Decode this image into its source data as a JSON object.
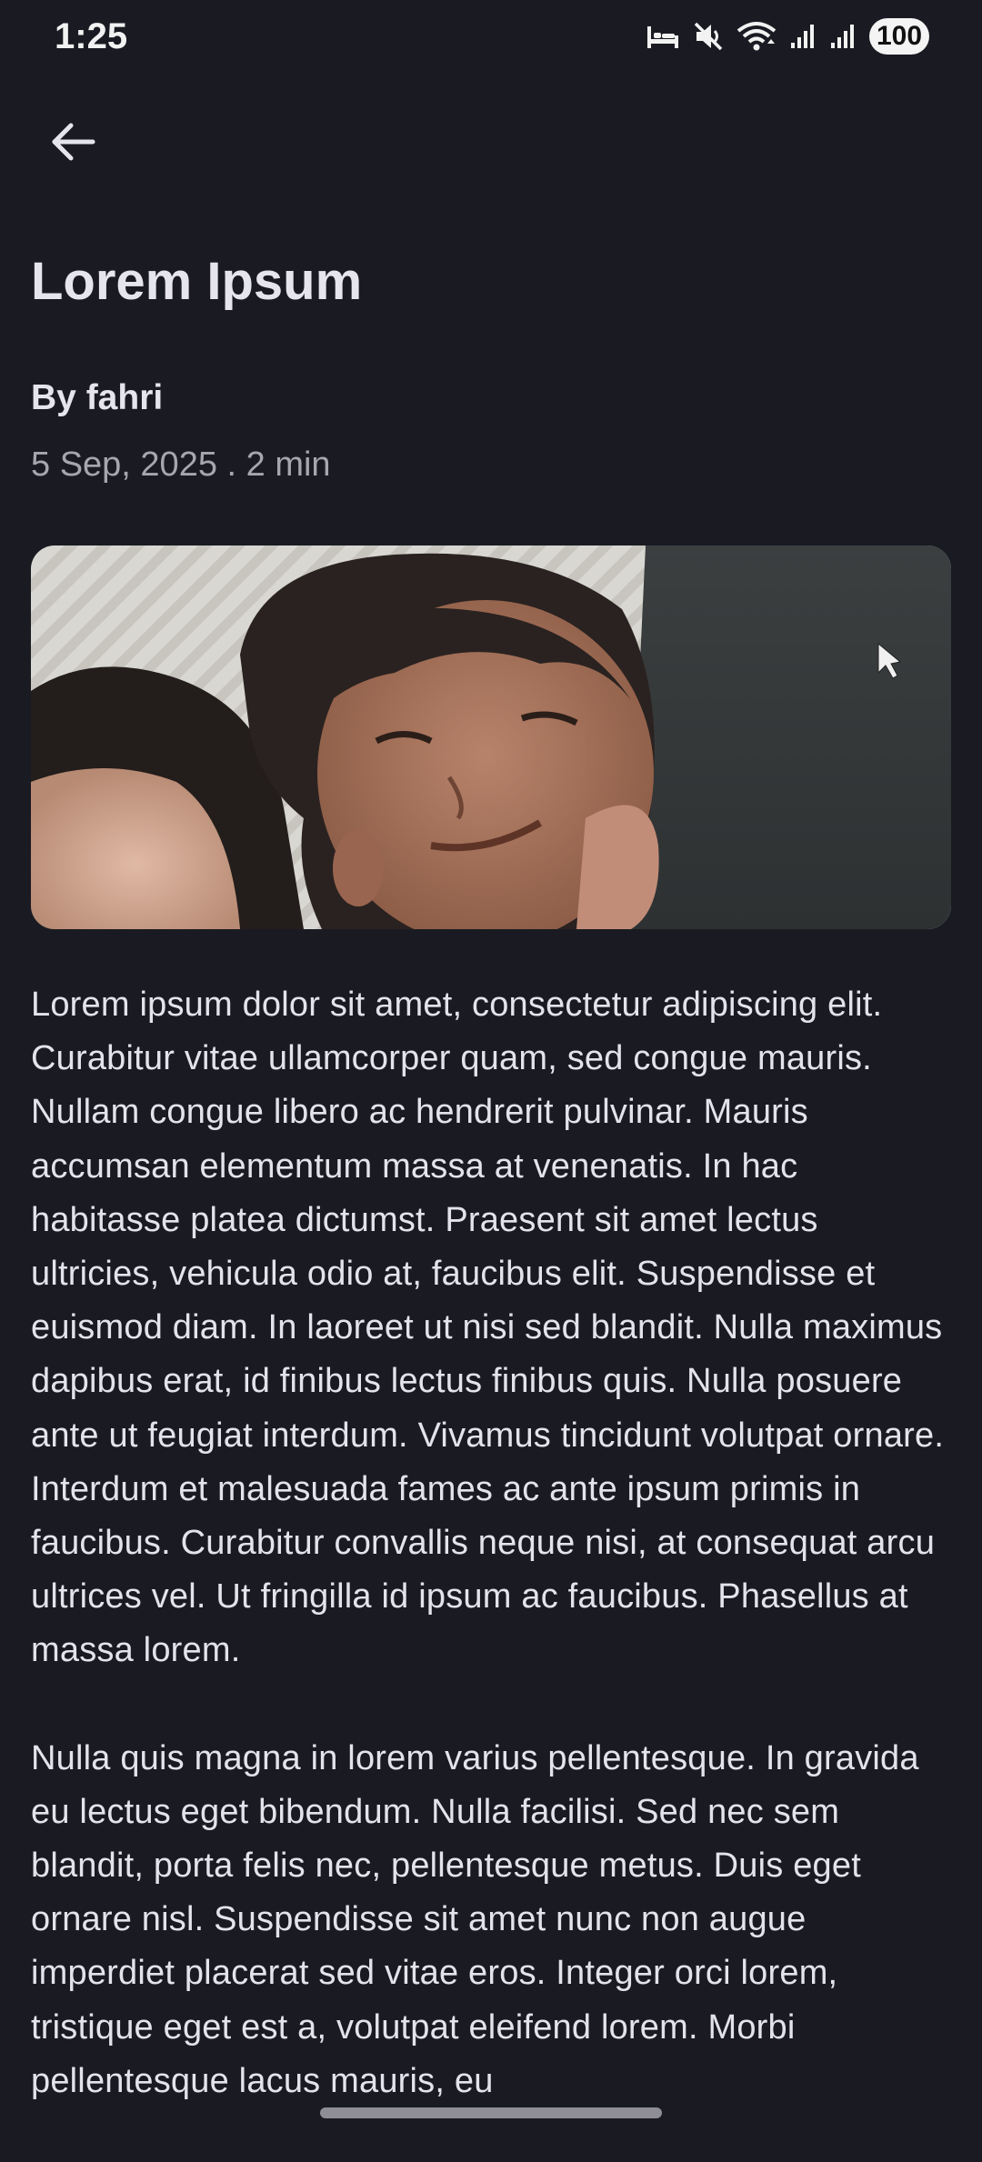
{
  "status_bar": {
    "time": "1:25",
    "battery": "100",
    "icons": [
      "sleep-mode-icon",
      "mute-icon",
      "wifi-icon",
      "signal-icon",
      "signal-icon"
    ]
  },
  "nav": {
    "back_icon": "arrow-back-icon"
  },
  "article": {
    "title": "Lorem Ipsum",
    "author": "By fahri",
    "meta": "5 Sep, 2025 . 2 min",
    "paragraphs": [
      "Lorem ipsum dolor sit amet, consectetur adipiscing elit. Curabitur vitae ullamcorper quam, sed congue mauris. Nullam congue libero ac hendrerit pulvinar. Mauris accumsan elementum massa at venenatis. In hac habitasse platea dictumst. Praesent sit amet lectus ultricies, vehicula odio at, faucibus elit. Suspendisse et euismod diam. In laoreet ut nisi sed blandit. Nulla maximus dapibus erat, id finibus lectus finibus quis. Nulla posuere ante ut feugiat interdum. Vivamus tincidunt volutpat ornare. Interdum et malesuada fames ac ante ipsum primis in faucibus. Curabitur convallis neque nisi, at consequat arcu ultrices vel. Ut fringilla id ipsum ac faucibus. Phasellus at massa lorem.",
      "Nulla quis magna in lorem varius pellentesque. In gravida eu lectus eget bibendum. Nulla facilisi. Sed nec sem blandit, porta felis nec, pellentesque metus. Duis eget ornare nisl. Suspendisse sit amet nunc non augue imperdiet placerat sed vitae eros. Integer orci lorem, tristique eget est a, volutpat eleifend lorem. Morbi pellentesque lacus mauris, eu"
    ]
  },
  "colors": {
    "background": "#1a1b22",
    "text_primary": "#e4e3ea",
    "text_secondary": "#a7a6ae"
  }
}
